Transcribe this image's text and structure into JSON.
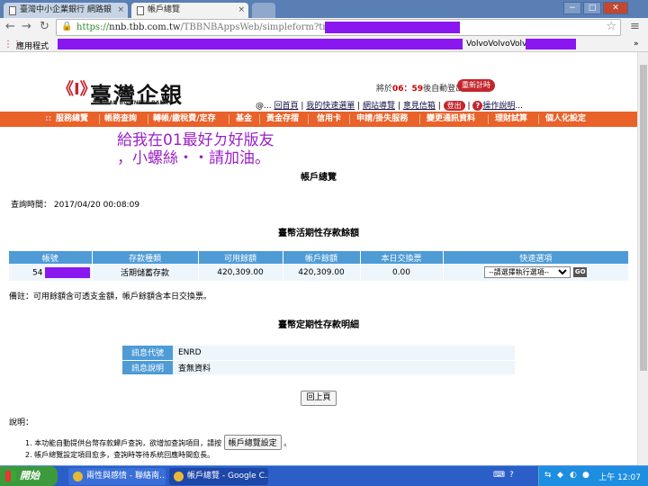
{
  "browser": {
    "tabs": [
      {
        "title": "臺灣中小企業銀行 網路銀",
        "active": false
      },
      {
        "title": "帳戶總覽",
        "active": true
      }
    ],
    "url_protocol": "https://",
    "url_host": "nnb.tbb.com.tw",
    "url_path": "/TBBNBAppsWeb/simpleform?trancode",
    "bookmarks_label": "應用程式",
    "bookmarks_tail": "VolvoVolvoVolvo",
    "window_buttons": {
      "minimize": "−",
      "restore": "□",
      "close": "✕"
    }
  },
  "header": {
    "logo_mark": "《I》",
    "logo_text": "臺灣企銀",
    "logo_en": "TAIWAN BUSINESS BANK",
    "timer_prefix": "將於",
    "timer_value": "06：59",
    "timer_suffix": "後自動登出",
    "renew_label": "重新計時",
    "toplinks": {
      "at": "@",
      "home": "回首頁",
      "quick_menu": "我的快速選單",
      "sitemap": "網站導覽",
      "feedback": "意見信箱",
      "logout": "登出",
      "help": "操作說明"
    }
  },
  "main_nav": {
    "items": [
      "服務總覽",
      "帳務查詢",
      "轉帳/繳稅費/定存",
      "基金",
      "黃金存摺",
      "信用卡",
      "申請/掛失服務",
      "變更通訊資料",
      "理財試算",
      "個人化設定"
    ]
  },
  "overlay_text": "給我在01最好ㄉ好版友\n，小螺絲・・請加油。",
  "page": {
    "title": "帳戶總覽",
    "query_time_label": "查詢時間：",
    "query_time": "2017/04/20 00:08:09"
  },
  "demand_deposit": {
    "heading": "臺幣活期性存款餘額",
    "columns": [
      "帳號",
      "存款種類",
      "可用餘額",
      "帳戶餘額",
      "本日交換票",
      "快速選項"
    ],
    "rows": [
      {
        "account": "54",
        "type": "活期儲蓄存款",
        "available": "420,309.00",
        "balance": "420,309.00",
        "clearing": "0.00",
        "quick_option": "--請選擇執行選項--",
        "go": "GO"
      }
    ],
    "remark": "備註：可用餘額含可透支金額，帳戶餘額含本日交換票。"
  },
  "time_deposit": {
    "heading": "臺幣定期性存款明細",
    "info": [
      {
        "label": "訊息代號",
        "value": "ENRD"
      },
      {
        "label": "訊息說明",
        "value": "查無資料"
      }
    ]
  },
  "back_label": "回上頁",
  "notes": {
    "label": "說明：",
    "items": [
      {
        "text": "1. 本功能自動提供台幣存款歸戶查詢，欲增加查詢項目，請按",
        "button": "帳戶總覽設定",
        "tail": "。"
      },
      {
        "text": "2. 帳戶總覽設定項目愈多，查詢時等待系統回應時間愈長。"
      }
    ]
  },
  "taskbar": {
    "start_label": "開始",
    "items": [
      "兩性與感情 - 聯絡南...",
      "帳戶總覽 - Google C..."
    ],
    "clock": "上午 12:07"
  },
  "colors": {
    "nav_orange": "#e8622a",
    "table_header_blue": "#4e9bd6",
    "brand_red": "#c4262e",
    "redaction_purple": "#8a17f0",
    "overlay_purple": "#9a20c8"
  }
}
